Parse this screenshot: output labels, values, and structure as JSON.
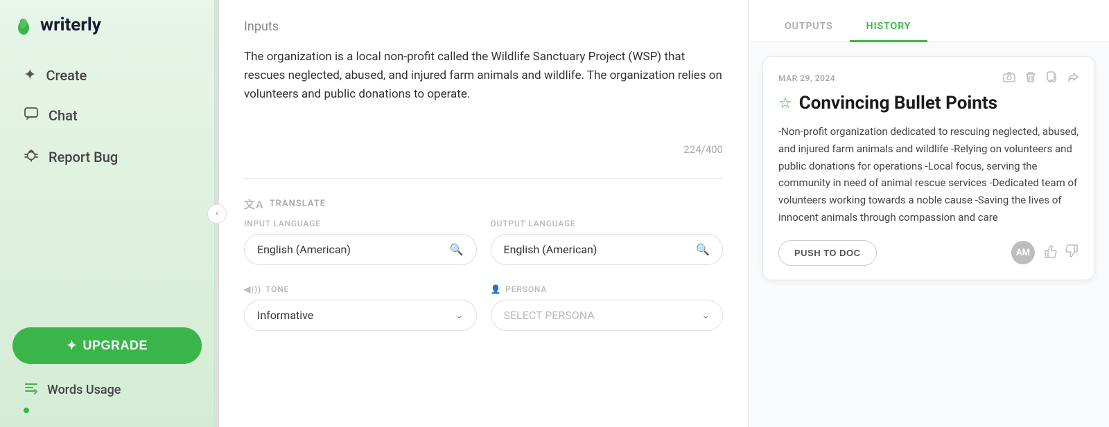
{
  "app": {
    "name": "writerly"
  },
  "sidebar": {
    "nav_items": [
      {
        "id": "create",
        "label": "Create",
        "icon": "✦"
      },
      {
        "id": "chat",
        "label": "Chat",
        "icon": "💬"
      },
      {
        "id": "report-bug",
        "label": "Report Bug",
        "icon": "🐛"
      }
    ],
    "upgrade_label": "UPGRADE",
    "upgrade_icon": "✦",
    "words_usage_label": "Words Usage"
  },
  "main": {
    "inputs_title": "Inputs",
    "textarea_content": "The organization is a local non-profit called the Wildlife Sanctuary Project (WSP) that rescues neglected, abused, and injured farm animals and wildlife. The organization relies on volunteers and public donations to operate.",
    "char_count": "224/400",
    "translate_section": {
      "label": "TRANSLATE",
      "input_language_label": "INPUT LANGUAGE",
      "output_language_label": "OUTPUT LANGUAGE",
      "input_language_value": "English (American)",
      "output_language_value": "English (American)"
    },
    "tone_section": {
      "label": "TONE",
      "value": "Informative"
    },
    "persona_section": {
      "label": "PERSONA",
      "placeholder": "SELECT PERSONA"
    }
  },
  "right_panel": {
    "tabs": [
      {
        "id": "outputs",
        "label": "OUTPUTS"
      },
      {
        "id": "history",
        "label": "HISTORY"
      }
    ],
    "active_tab": "history",
    "history_card": {
      "date": "MAR 29, 2024",
      "title": "Convincing Bullet Points",
      "body": "-Non-profit organization dedicated to rescuing neglected, abused, and injured farm animals and wildlife -Relying on volunteers and public donations for operations -Local focus, serving the community in need of animal rescue services -Dedicated team of volunteers working towards a noble cause -Saving the lives of innocent animals through compassion and care",
      "push_btn_label": "PUSH TO DOC",
      "avatar_initials": "AM"
    }
  },
  "icons": {
    "collapse": "‹",
    "search": "🔍",
    "chevron_down": "⌄",
    "star": "☆",
    "camera": "📷",
    "trash": "🗑",
    "copy": "⧉",
    "share": "↪",
    "thumb_up": "👍",
    "thumb_down": "👎",
    "translate": "文A",
    "tone": "◀)))",
    "persona": "👤"
  },
  "colors": {
    "green": "#3ab54a",
    "light_bg": "#e8f5e9"
  }
}
